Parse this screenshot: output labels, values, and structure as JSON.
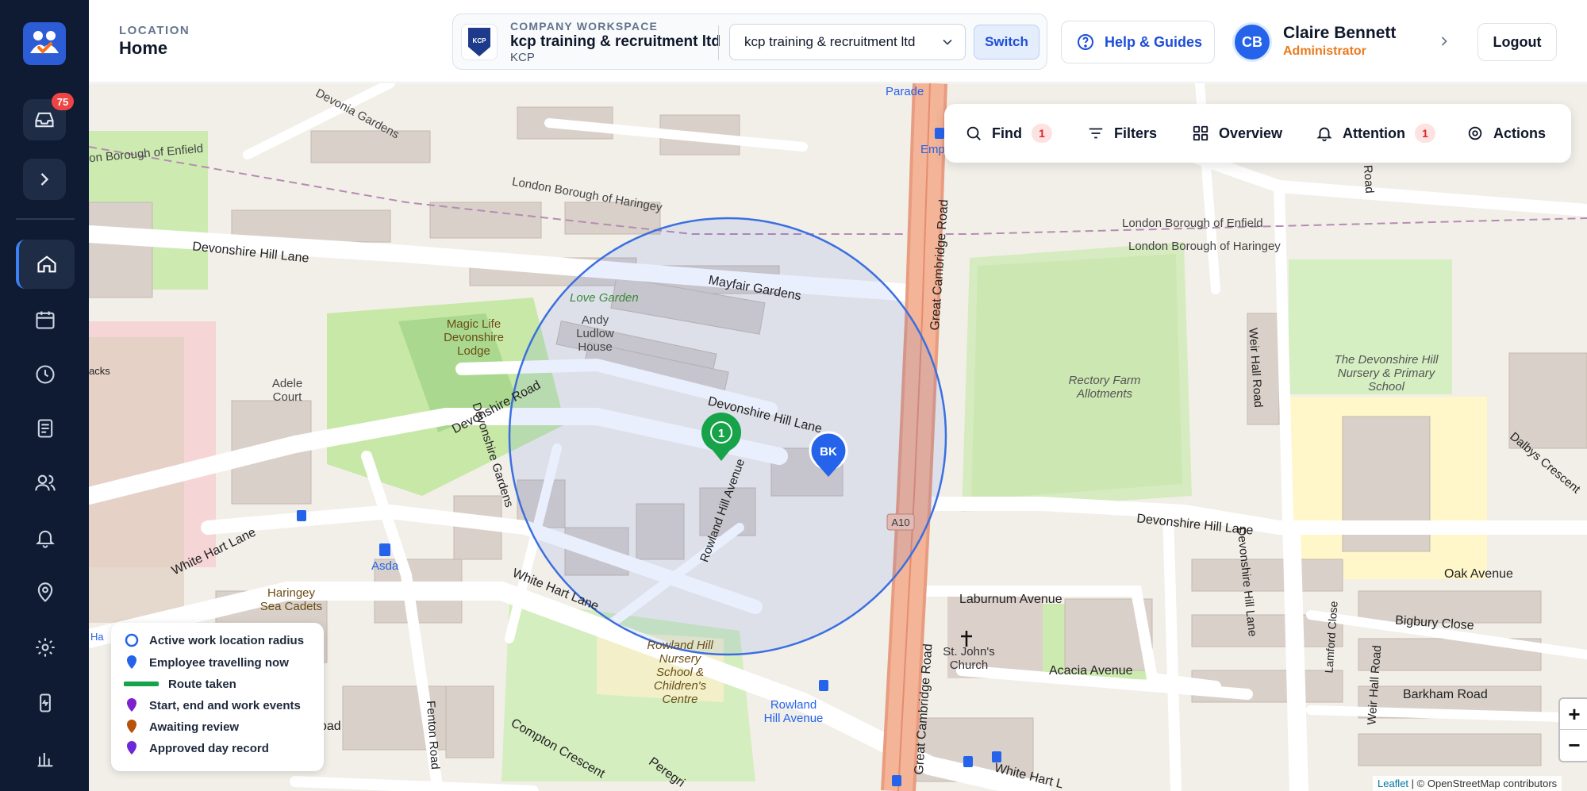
{
  "sidebar": {
    "inbox_badge": "75",
    "nav": [
      "home",
      "calendar",
      "clock",
      "document",
      "users",
      "bell",
      "location-pin",
      "settings",
      "mobile",
      "reports"
    ]
  },
  "header": {
    "location_label": "LOCATION",
    "location_value": "Home",
    "workspace": {
      "label": "COMPANY WORKSPACE",
      "name": "kcp training & recruitment ltd",
      "code": "KCP",
      "logo_text": "KCP",
      "selected": "kcp training & recruitment ltd",
      "switch_label": "Switch"
    },
    "help_label": "Help & Guides",
    "user": {
      "initials": "CB",
      "name": "Claire Bennett",
      "role": "Administrator"
    },
    "logout_label": "Logout"
  },
  "toolbar": {
    "find_label": "Find",
    "find_count": "1",
    "filters_label": "Filters",
    "overview_label": "Overview",
    "attention_label": "Attention",
    "attention_count": "1",
    "actions_label": "Actions"
  },
  "map": {
    "cluster_count": "1",
    "employee_marker": "BK",
    "labels": {
      "devonia": "Devonia Gardens",
      "enfield_west": "on Borough of Enfield",
      "haringey_top": "London Borough of Haringey",
      "enfield_right": "London Borough of Enfield",
      "haringey_right": "London Borough of Haringey",
      "devonshire_hill_lane_w": "Devonshire Hill Lane",
      "mayfair": "Mayfair Gardens",
      "love_garden": "Love Garden",
      "andy_ludlow": "Andy Ludlow House",
      "magic_life": "Magic Life Devonshire Lodge",
      "adele": "Adele Court",
      "devonshire_road": "Devonshire Road",
      "devonshire_gardens": "Devonshire Gardens",
      "devonshire_hill_lane_c": "Devonshire Hill Lane",
      "rowland_hill_avenue": "Rowland Hill Avenue",
      "white_hart_lane_w": "White Hart Lane",
      "white_hart_lane_c": "White Hart Lane",
      "asda": "Asda",
      "haringey_sea_cadets": "Haringey Sea Cadets",
      "rowland_school": "Rowland Hill Nursery School & Children's Centre",
      "rowland_hill_avenue_stop": "Rowland Hill Avenue",
      "great_cambridge_top": "Great Cambridge Road",
      "great_cambridge_bottom": "Great Cambridge Road",
      "a10": "A10",
      "parade": "Parade",
      "emp": "Emp",
      "rectory": "Rectory Farm Allotments",
      "devonshire_school": "The Devonshire Hill Nursery & Primary School",
      "weir_hall_road_top": "Weir Hall Road",
      "weir_hall_road_bottom": "Weir Hall Road",
      "dalbys": "Dalbys Crescent",
      "devonshire_hill_lane_e": "Devonshire Hill Lane",
      "devonshire_hill_lane_e2": "Devonshire Hill Lane",
      "oak_avenue": "Oak Avenue",
      "laburnum": "Laburnum Avenue",
      "bigbury": "Bigbury Close",
      "st_johns": "St. John's Church",
      "acacia": "Acacia Avenue",
      "lamford": "Lamford Close",
      "barkham": "Barkham Road",
      "daubeney": "Daubeney Road",
      "fenton": "Fenton Road",
      "compton": "Compton Crescent",
      "peregrine": "Peregri",
      "white_hart_lane_e": "White Hart L",
      "rowland_hill_road": "Rowland Hill Road",
      "hacks": "acks",
      "ha": "Ha"
    }
  },
  "legend": {
    "items": [
      {
        "label": "Active work location radius",
        "symbol": "circle",
        "color": "#2563eb"
      },
      {
        "label": "Employee travelling now",
        "symbol": "pin",
        "color": "#2563eb"
      },
      {
        "label": "Route taken",
        "symbol": "line",
        "color": "#16a34a"
      },
      {
        "label": "Start, end and work events",
        "symbol": "pin",
        "color": "#7e22ce"
      },
      {
        "label": "Awaiting review",
        "symbol": "pin",
        "color": "#b45309"
      },
      {
        "label": "Approved day record",
        "symbol": "pin",
        "color": "#6d28d9"
      }
    ]
  },
  "attribution": {
    "leaflet": "Leaflet",
    "osm": "| © OpenStreetMap contributors"
  },
  "zoom": {
    "in": "+",
    "out": "−"
  }
}
